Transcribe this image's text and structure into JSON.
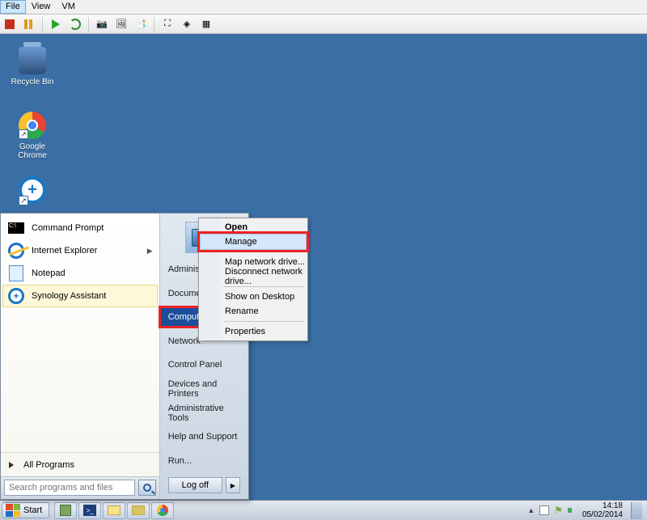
{
  "vm_menu": {
    "file": "File",
    "view": "View",
    "vm": "VM"
  },
  "desktop_icons": {
    "recycle": "Recycle Bin",
    "chrome": "Google Chrome",
    "synology": ""
  },
  "start_menu": {
    "programs": {
      "cmd": "Command Prompt",
      "ie": "Internet Explorer",
      "notepad": "Notepad",
      "synology": "Synology Assistant"
    },
    "all_programs": "All Programs",
    "search_placeholder": "Search programs and files",
    "right": {
      "user": "Administrator",
      "documents": "Documents",
      "computer": "Computer",
      "network": "Network",
      "controlpanel": "Control Panel",
      "devices": "Devices and Printers",
      "admintools": "Administrative Tools",
      "help": "Help and Support",
      "run": "Run..."
    },
    "logoff": "Log off"
  },
  "context_menu": {
    "open": "Open",
    "manage": "Manage",
    "mapdrive": "Map network drive...",
    "disconnect": "Disconnect network drive...",
    "showdesk": "Show on Desktop",
    "rename": "Rename",
    "properties": "Properties"
  },
  "taskbar": {
    "start": "Start",
    "time": "14:18",
    "date": "05/02/2014"
  }
}
